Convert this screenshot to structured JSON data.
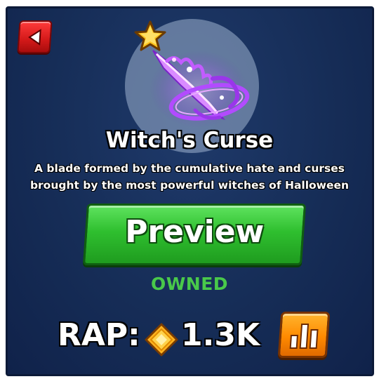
{
  "navigation": {
    "back_icon": "back-arrow-icon"
  },
  "item": {
    "name": "Witch's Curse",
    "description": "A blade formed by the cumulative hate and curses brought by the most powerful witches of Halloween",
    "art_icon": "purple-blade-icon",
    "favorite_icon": "star-icon",
    "glow_color": "#b24bff"
  },
  "actions": {
    "preview_label": "Preview"
  },
  "status": {
    "label": "OWNED",
    "color": "#49c94a"
  },
  "rap": {
    "label": "RAP:",
    "value": "1.3K",
    "currency_icon": "diamond-coin-icon",
    "stats_icon": "bar-chart-icon"
  }
}
